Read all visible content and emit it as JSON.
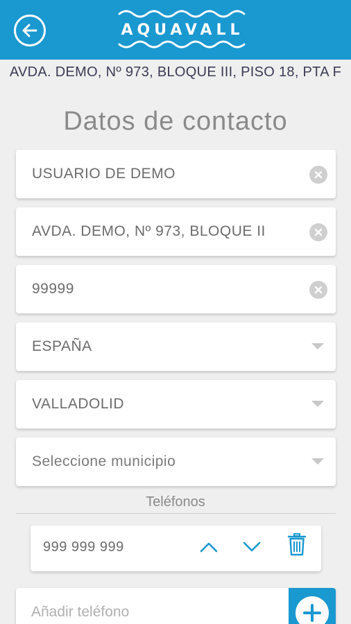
{
  "header": {
    "logo_text": "AQUAVALL",
    "brand_color": "#1a98d0"
  },
  "address": "AVDA. DEMO, Nº 973, BLOQUE III, PISO 18, PTA F",
  "section_title": "Datos de contacto",
  "fields": [
    {
      "value": "USUARIO DE DEMO",
      "type": "text-clearable"
    },
    {
      "value": "AVDA. DEMO, Nº 973, BLOQUE II",
      "type": "text-clearable"
    },
    {
      "value": "99999",
      "type": "text-clearable"
    },
    {
      "value": "ESPAÑA",
      "type": "select"
    },
    {
      "value": "VALLADOLID",
      "type": "select"
    },
    {
      "value": "Seleccione municipio",
      "type": "select"
    }
  ],
  "phones": {
    "label": "Teléfonos",
    "items": [
      {
        "number": "999 999 999"
      }
    ],
    "add_placeholder": "Añadir teléfono"
  }
}
